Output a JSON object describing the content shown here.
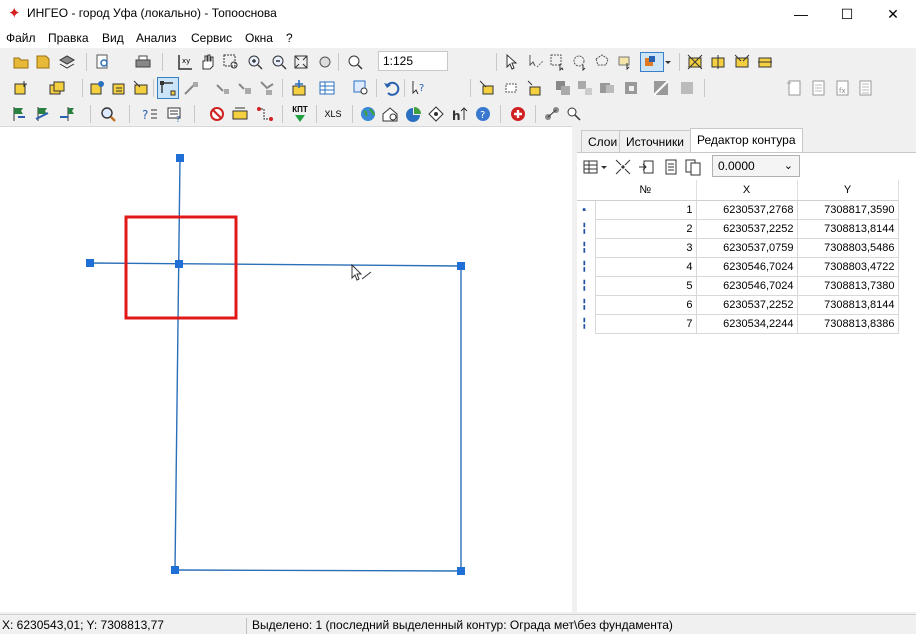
{
  "window": {
    "title": "ИНГЕО - город Уфа (локально) - Топооснова",
    "minimize": "—",
    "maximize": "☐",
    "close": "✕"
  },
  "menu": [
    "Файл",
    "Правка",
    "Вид",
    "Анализ",
    "Сервис",
    "Окна",
    "?"
  ],
  "toolbar": {
    "scale_value": "1:125",
    "xls_label": "XLS",
    "kpt_label": "КПТ"
  },
  "panel": {
    "tabs": [
      "Слои",
      "Источники",
      "Редактор контура"
    ],
    "active_tab": "Редактор контура",
    "precision_value": "0.0000",
    "columns": [
      "№",
      "X",
      "Y"
    ],
    "rows": [
      {
        "n": "1",
        "x": "6230537,2768",
        "y": "7308817,3590"
      },
      {
        "n": "2",
        "x": "6230537,2252",
        "y": "7308813,8144"
      },
      {
        "n": "3",
        "x": "6230537,0759",
        "y": "7308803,5486"
      },
      {
        "n": "4",
        "x": "6230546,7024",
        "y": "7308803,4722"
      },
      {
        "n": "5",
        "x": "6230546,7024",
        "y": "7308813,7380"
      },
      {
        "n": "6",
        "x": "6230537,2252",
        "y": "7308813,8144"
      },
      {
        "n": "7",
        "x": "6230534,2244",
        "y": "7308813,8386"
      }
    ]
  },
  "status": {
    "coords": "X: 6230543,01; Y: 7308813,77",
    "selection": "Выделено: 1 (последний выделенный контур: Ограда мет\\без фундамента)"
  },
  "colors": {
    "line": "#2a6fb8",
    "vertex": "#1f6fd6",
    "highlight": "#e01818"
  }
}
